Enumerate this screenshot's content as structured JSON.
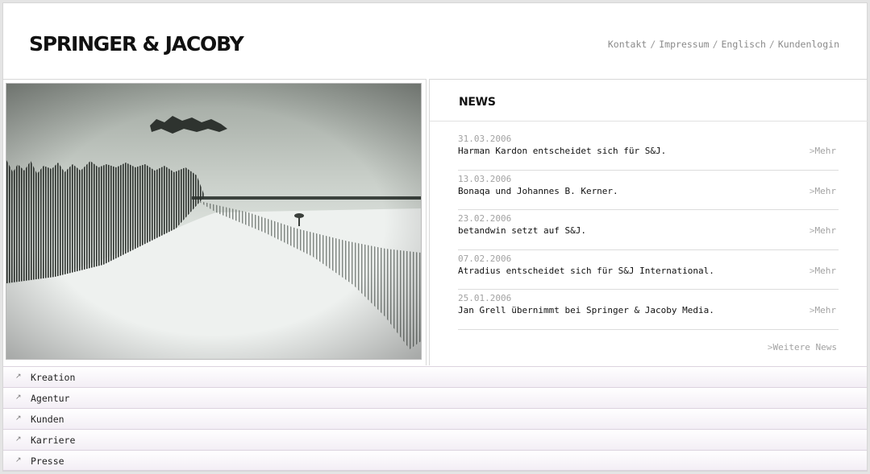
{
  "header": {
    "logo_text": "SPRINGER & JACOBY",
    "links": [
      {
        "label": "Kontakt"
      },
      {
        "label": "Impressum"
      },
      {
        "label": "Englisch"
      },
      {
        "label": "Kundenlogin"
      }
    ],
    "separator": "/"
  },
  "news": {
    "title": "NEWS",
    "items": [
      {
        "date": "31.03.2006",
        "text": "Harman Kardon entscheidet sich für S&J.",
        "more": "Mehr"
      },
      {
        "date": "13.03.2006",
        "text": " Bonaqa und Johannes B. Kerner.",
        "more": "Mehr"
      },
      {
        "date": "23.02.2006",
        "text": "betandwin setzt auf S&J.",
        "more": "Mehr"
      },
      {
        "date": "07.02.2006",
        "text": "Atradius entscheidet sich für S&J International.",
        "more": "Mehr"
      },
      {
        "date": "25.01.2006",
        "text": "Jan Grell übernimmt bei Springer & Jacoby Media.",
        "more": "Mehr"
      }
    ],
    "more_news": "Weitere News",
    "caret": ">"
  },
  "nav": {
    "arrow": "↗",
    "items": [
      {
        "label": "Kreation"
      },
      {
        "label": "Agentur"
      },
      {
        "label": "Kunden"
      },
      {
        "label": "Karriere"
      },
      {
        "label": "Presse"
      }
    ]
  },
  "colors": {
    "background": "#e4e4e4",
    "nav_row": "#f3eef5",
    "muted_text": "#a2a2a2",
    "text": "#111111"
  }
}
